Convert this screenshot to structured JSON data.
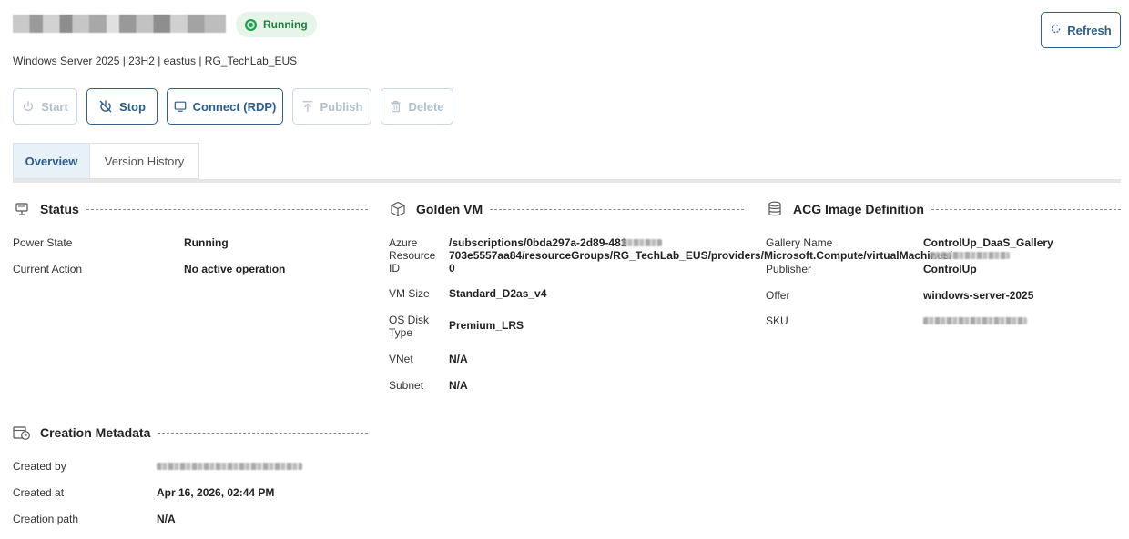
{
  "header": {
    "status_badge": "Running",
    "subtitle": "Windows Server 2025 | 23H2 | eastus | RG_TechLab_EUS",
    "refresh_label": "Refresh"
  },
  "actions": {
    "start": "Start",
    "stop": "Stop",
    "connect": "Connect (RDP)",
    "publish": "Publish",
    "delete": "Delete"
  },
  "tabs": [
    {
      "label": "Overview",
      "active": true
    },
    {
      "label": "Version History",
      "active": false
    }
  ],
  "status_section": {
    "title": "Status",
    "icon": "status-monitor-icon",
    "rows": [
      {
        "label": "Power State",
        "value": "Running"
      },
      {
        "label": "Current Action",
        "value": "No active operation"
      }
    ]
  },
  "golden_vm_section": {
    "title": "Golden VM",
    "icon": "cube-icon",
    "azure_resource_id_label": "Azure Resource ID",
    "azure_resource_id_line1": "/subscriptions/0bda297a-2d89-481",
    "azure_resource_id_line2": "703e5557aa84/resourceGroups/RG_TechLab_EUS/providers/Microsoft.Compute/virtualMachines/",
    "azure_resource_id_line3": "0",
    "rows": [
      {
        "label": "VM Size",
        "value": "Standard_D2as_v4"
      },
      {
        "label": "OS Disk Type",
        "value": "Premium_LRS"
      },
      {
        "label": "VNet",
        "value": "N/A"
      },
      {
        "label": "Subnet",
        "value": "N/A"
      }
    ]
  },
  "acg_section": {
    "title": "ACG Image Definition",
    "icon": "database-icon",
    "rows": [
      {
        "label": "Gallery Name",
        "value": "ControlUp_DaaS_Gallery"
      },
      {
        "label": "Publisher",
        "value": "ControlUp"
      },
      {
        "label": "Offer",
        "value": "windows-server-2025"
      },
      {
        "label": "SKU",
        "value": ""
      }
    ]
  },
  "creation_section": {
    "title": "Creation Metadata",
    "icon": "calendar-clock-icon",
    "rows": [
      {
        "label": "Created by",
        "value": ""
      },
      {
        "label": "Created at",
        "value": "Apr 16, 2026, 02:44 PM"
      },
      {
        "label": "Creation path",
        "value": "N/A"
      }
    ]
  },
  "colors": {
    "accent": "#2c5d8c",
    "running_green": "#1e9e4a",
    "badge_bg": "#e6f4ea",
    "disabled": "#b2c0cd"
  }
}
